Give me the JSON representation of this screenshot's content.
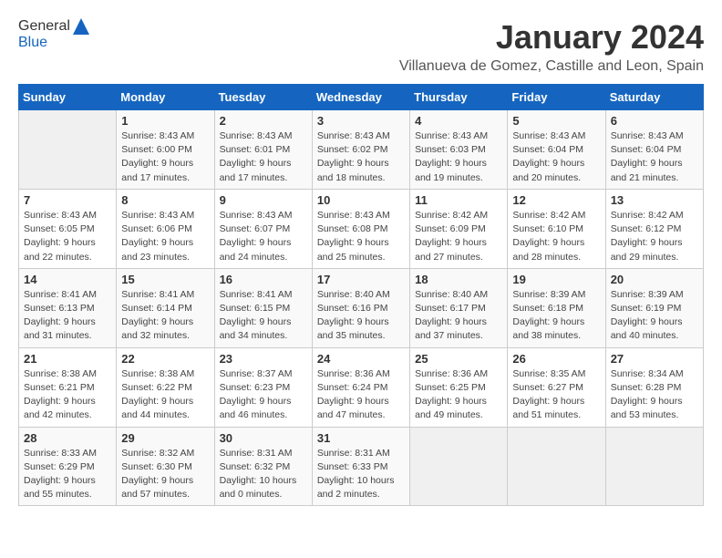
{
  "header": {
    "logo_general": "General",
    "logo_blue": "Blue",
    "month_title": "January 2024",
    "location": "Villanueva de Gomez, Castille and Leon, Spain"
  },
  "weekdays": [
    "Sunday",
    "Monday",
    "Tuesday",
    "Wednesday",
    "Thursday",
    "Friday",
    "Saturday"
  ],
  "weeks": [
    [
      {
        "day": "",
        "info": ""
      },
      {
        "day": "1",
        "info": "Sunrise: 8:43 AM\nSunset: 6:00 PM\nDaylight: 9 hours\nand 17 minutes."
      },
      {
        "day": "2",
        "info": "Sunrise: 8:43 AM\nSunset: 6:01 PM\nDaylight: 9 hours\nand 17 minutes."
      },
      {
        "day": "3",
        "info": "Sunrise: 8:43 AM\nSunset: 6:02 PM\nDaylight: 9 hours\nand 18 minutes."
      },
      {
        "day": "4",
        "info": "Sunrise: 8:43 AM\nSunset: 6:03 PM\nDaylight: 9 hours\nand 19 minutes."
      },
      {
        "day": "5",
        "info": "Sunrise: 8:43 AM\nSunset: 6:04 PM\nDaylight: 9 hours\nand 20 minutes."
      },
      {
        "day": "6",
        "info": "Sunrise: 8:43 AM\nSunset: 6:04 PM\nDaylight: 9 hours\nand 21 minutes."
      }
    ],
    [
      {
        "day": "7",
        "info": "Sunrise: 8:43 AM\nSunset: 6:05 PM\nDaylight: 9 hours\nand 22 minutes."
      },
      {
        "day": "8",
        "info": "Sunrise: 8:43 AM\nSunset: 6:06 PM\nDaylight: 9 hours\nand 23 minutes."
      },
      {
        "day": "9",
        "info": "Sunrise: 8:43 AM\nSunset: 6:07 PM\nDaylight: 9 hours\nand 24 minutes."
      },
      {
        "day": "10",
        "info": "Sunrise: 8:43 AM\nSunset: 6:08 PM\nDaylight: 9 hours\nand 25 minutes."
      },
      {
        "day": "11",
        "info": "Sunrise: 8:42 AM\nSunset: 6:09 PM\nDaylight: 9 hours\nand 27 minutes."
      },
      {
        "day": "12",
        "info": "Sunrise: 8:42 AM\nSunset: 6:10 PM\nDaylight: 9 hours\nand 28 minutes."
      },
      {
        "day": "13",
        "info": "Sunrise: 8:42 AM\nSunset: 6:12 PM\nDaylight: 9 hours\nand 29 minutes."
      }
    ],
    [
      {
        "day": "14",
        "info": "Sunrise: 8:41 AM\nSunset: 6:13 PM\nDaylight: 9 hours\nand 31 minutes."
      },
      {
        "day": "15",
        "info": "Sunrise: 8:41 AM\nSunset: 6:14 PM\nDaylight: 9 hours\nand 32 minutes."
      },
      {
        "day": "16",
        "info": "Sunrise: 8:41 AM\nSunset: 6:15 PM\nDaylight: 9 hours\nand 34 minutes."
      },
      {
        "day": "17",
        "info": "Sunrise: 8:40 AM\nSunset: 6:16 PM\nDaylight: 9 hours\nand 35 minutes."
      },
      {
        "day": "18",
        "info": "Sunrise: 8:40 AM\nSunset: 6:17 PM\nDaylight: 9 hours\nand 37 minutes."
      },
      {
        "day": "19",
        "info": "Sunrise: 8:39 AM\nSunset: 6:18 PM\nDaylight: 9 hours\nand 38 minutes."
      },
      {
        "day": "20",
        "info": "Sunrise: 8:39 AM\nSunset: 6:19 PM\nDaylight: 9 hours\nand 40 minutes."
      }
    ],
    [
      {
        "day": "21",
        "info": "Sunrise: 8:38 AM\nSunset: 6:21 PM\nDaylight: 9 hours\nand 42 minutes."
      },
      {
        "day": "22",
        "info": "Sunrise: 8:38 AM\nSunset: 6:22 PM\nDaylight: 9 hours\nand 44 minutes."
      },
      {
        "day": "23",
        "info": "Sunrise: 8:37 AM\nSunset: 6:23 PM\nDaylight: 9 hours\nand 46 minutes."
      },
      {
        "day": "24",
        "info": "Sunrise: 8:36 AM\nSunset: 6:24 PM\nDaylight: 9 hours\nand 47 minutes."
      },
      {
        "day": "25",
        "info": "Sunrise: 8:36 AM\nSunset: 6:25 PM\nDaylight: 9 hours\nand 49 minutes."
      },
      {
        "day": "26",
        "info": "Sunrise: 8:35 AM\nSunset: 6:27 PM\nDaylight: 9 hours\nand 51 minutes."
      },
      {
        "day": "27",
        "info": "Sunrise: 8:34 AM\nSunset: 6:28 PM\nDaylight: 9 hours\nand 53 minutes."
      }
    ],
    [
      {
        "day": "28",
        "info": "Sunrise: 8:33 AM\nSunset: 6:29 PM\nDaylight: 9 hours\nand 55 minutes."
      },
      {
        "day": "29",
        "info": "Sunrise: 8:32 AM\nSunset: 6:30 PM\nDaylight: 9 hours\nand 57 minutes."
      },
      {
        "day": "30",
        "info": "Sunrise: 8:31 AM\nSunset: 6:32 PM\nDaylight: 10 hours\nand 0 minutes."
      },
      {
        "day": "31",
        "info": "Sunrise: 8:31 AM\nSunset: 6:33 PM\nDaylight: 10 hours\nand 2 minutes."
      },
      {
        "day": "",
        "info": ""
      },
      {
        "day": "",
        "info": ""
      },
      {
        "day": "",
        "info": ""
      }
    ]
  ]
}
